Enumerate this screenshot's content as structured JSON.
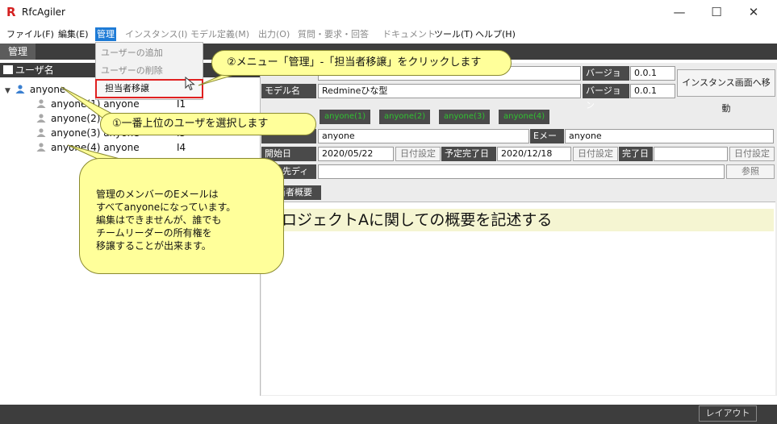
{
  "window": {
    "title": "RfcAgiler",
    "logo_letter": "R"
  },
  "window_controls": {
    "minimize": "—",
    "maximize": "☐",
    "close": "✕"
  },
  "menubar": {
    "file": "ファイル(F)",
    "edit": "編集(E)",
    "manage": "管理",
    "instance": "インスタンス(I)",
    "model_def": "モデル定義(M)",
    "output": "出力(O)",
    "qa": "質問・要求・回答",
    "document": "ドキュメント",
    "tools": "ツール(T)",
    "help": "ヘルプ(H)"
  },
  "top_tab": "管理",
  "dropdown": {
    "add_user": "ユーザーの追加",
    "delete_user": "ユーザーの削除",
    "transfer": "担当者移譲"
  },
  "left_panel": {
    "header": "ユーザ名",
    "tree": [
      {
        "name": "anyone",
        "col": ""
      },
      {
        "name": "anyone(1) anyone",
        "col": "I1"
      },
      {
        "name": "anyone(2) anyone",
        "col": "I2"
      },
      {
        "name": "anyone(3) anyone",
        "col": "I3"
      },
      {
        "name": "anyone(4) anyone",
        "col": "I4"
      }
    ]
  },
  "right_panel": {
    "model_label": "モデル名",
    "model_value": "Redmineひな型",
    "version_label": "バージョン",
    "version_value_top": "0.0.1",
    "version_value": "0.0.1",
    "move_button": "インスタンス画面へ移動",
    "tabs": [
      "anyone(1)",
      "anyone(2)",
      "anyone(3)",
      "anyone(4)"
    ],
    "owner_value": "anyone",
    "email_label": "Eメール",
    "email_value": "anyone",
    "start_label": "開始日",
    "start_value": "2020/05/22",
    "set_date": "日付設定",
    "planned_label": "予定完了日",
    "planned_value": "2020/12/18",
    "done_label": "完了日",
    "output_dir_label": "出力先ディレ",
    "browse": "参照",
    "summary_tab": "担当者概要",
    "summary_text": "プロジェクトAに関しての概要を記述する"
  },
  "callouts": {
    "step1": "①一番上位のユーザを選択します",
    "step2": "②メニュー「管理」-「担当者移譲」をクリックします",
    "note_lines": [
      "管理のメンバーのEメールは",
      "すべてanyoneになっています。",
      "編集はできませんが、誰でも",
      "チームリーダーの所有権を",
      "移譲することが出来ます。"
    ]
  },
  "statusbar": {
    "layout": "レイアウト"
  }
}
